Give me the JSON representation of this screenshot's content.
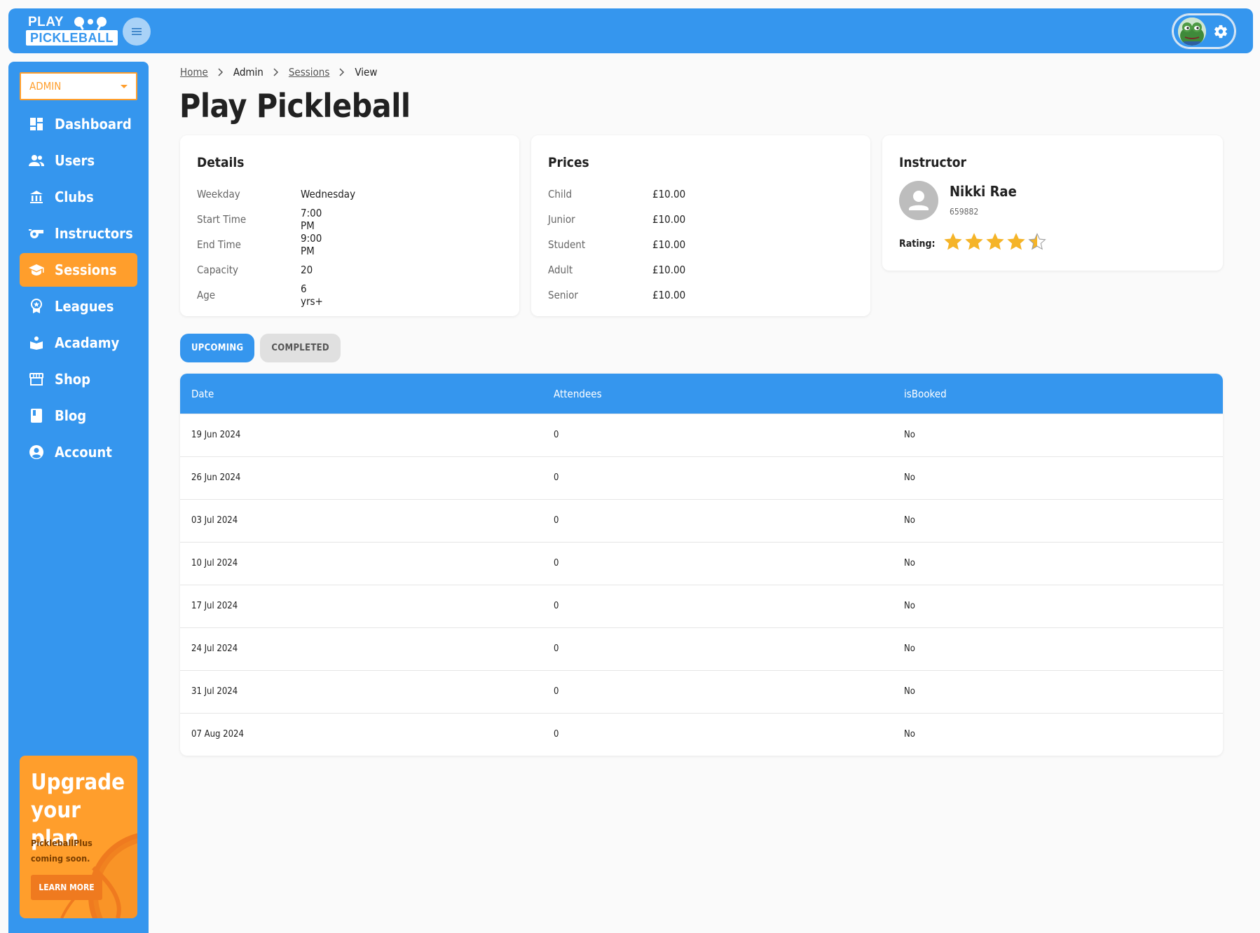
{
  "brand": {
    "line1": "PLAY",
    "line2": "PICKLEBALL"
  },
  "colors": {
    "primary": "#3596ee",
    "accent": "#ff9e2c",
    "star": "#f5b428"
  },
  "sidebar": {
    "role": "ADMIN",
    "items": [
      {
        "label": "Dashboard",
        "icon": "dashboard-icon",
        "active": false
      },
      {
        "label": "Users",
        "icon": "users-icon",
        "active": false
      },
      {
        "label": "Clubs",
        "icon": "clubs-icon",
        "active": false
      },
      {
        "label": "Instructors",
        "icon": "whistle-icon",
        "active": false
      },
      {
        "label": "Sessions",
        "icon": "graduation-cap-icon",
        "active": true
      },
      {
        "label": "Leagues",
        "icon": "award-icon",
        "active": false
      },
      {
        "label": "Acadamy",
        "icon": "academy-icon",
        "active": false
      },
      {
        "label": "Shop",
        "icon": "store-icon",
        "active": false
      },
      {
        "label": "Blog",
        "icon": "book-icon",
        "active": false
      },
      {
        "label": "Account",
        "icon": "account-circle-icon",
        "active": false
      }
    ],
    "upgrade": {
      "title": "Upgrade your plan",
      "text": "PickleballPlus coming soon.",
      "button": "LEARN MORE"
    }
  },
  "breadcrumb": {
    "home": "Home",
    "admin": "Admin",
    "sessions": "Sessions",
    "current": "View"
  },
  "page_title": "Play Pickleball",
  "details": {
    "heading": "Details",
    "rows": [
      {
        "label": "Weekday",
        "value": "Wednesday"
      },
      {
        "label": "Start Time",
        "value": "7:00 PM"
      },
      {
        "label": "End Time",
        "value": "9:00 PM"
      },
      {
        "label": "Capacity",
        "value": "20"
      },
      {
        "label": "Age",
        "value": "6 yrs+"
      }
    ]
  },
  "prices": {
    "heading": "Prices",
    "rows": [
      {
        "label": "Child",
        "value": "£10.00"
      },
      {
        "label": "Junior",
        "value": "£10.00"
      },
      {
        "label": "Student",
        "value": "£10.00"
      },
      {
        "label": "Adult",
        "value": "£10.00"
      },
      {
        "label": "Senior",
        "value": "£10.00"
      }
    ]
  },
  "instructor": {
    "heading": "Instructor",
    "name": "Nikki Rae",
    "id": "659882",
    "rating_label": "Rating:",
    "rating": 4.5,
    "rating_max": 5
  },
  "tabs": {
    "upcoming": "UPCOMING",
    "completed": "COMPLETED",
    "active": "upcoming"
  },
  "table": {
    "headers": {
      "date": "Date",
      "attendees": "Attendees",
      "booked": "isBooked"
    },
    "rows": [
      {
        "date": "19 Jun 2024",
        "attendees": "0",
        "booked": "No"
      },
      {
        "date": "26 Jun 2024",
        "attendees": "0",
        "booked": "No"
      },
      {
        "date": "03 Jul 2024",
        "attendees": "0",
        "booked": "No"
      },
      {
        "date": "10 Jul 2024",
        "attendees": "0",
        "booked": "No"
      },
      {
        "date": "17 Jul 2024",
        "attendees": "0",
        "booked": "No"
      },
      {
        "date": "24 Jul 2024",
        "attendees": "0",
        "booked": "No"
      },
      {
        "date": "31 Jul 2024",
        "attendees": "0",
        "booked": "No"
      },
      {
        "date": "07 Aug 2024",
        "attendees": "0",
        "booked": "No"
      }
    ]
  }
}
